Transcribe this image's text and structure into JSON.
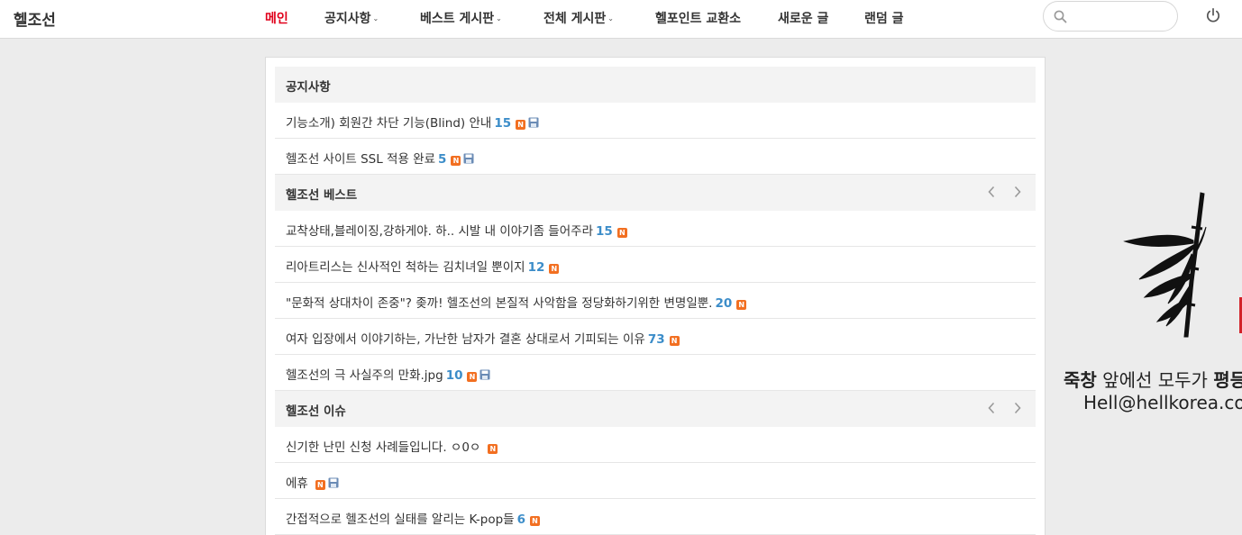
{
  "header": {
    "logo": "헬조선",
    "nav": [
      {
        "label": "메인",
        "active": true,
        "dropdown": false
      },
      {
        "label": "공지사항",
        "active": false,
        "dropdown": true
      },
      {
        "label": "베스트 게시판",
        "active": false,
        "dropdown": true
      },
      {
        "label": "전체 게시판",
        "active": false,
        "dropdown": true
      },
      {
        "label": "헬포인트 교환소",
        "active": false,
        "dropdown": false
      },
      {
        "label": "새로운 글",
        "active": false,
        "dropdown": false
      },
      {
        "label": "랜덤 글",
        "active": false,
        "dropdown": false
      }
    ],
    "search": {
      "value": "",
      "placeholder": ""
    },
    "icons": {
      "search": "search-icon",
      "power": "power-icon"
    }
  },
  "sections": [
    {
      "title": "공지사항",
      "has_arrows": false,
      "items": [
        {
          "text": "기능소개) 회원간 차단 기능(Blind) 안내",
          "count": "15",
          "new": true,
          "attachment": true
        },
        {
          "text": "헬조선 사이트 SSL 적용 완료",
          "count": "5",
          "new": true,
          "attachment": true
        }
      ]
    },
    {
      "title": "헬조선 베스트",
      "has_arrows": true,
      "items": [
        {
          "text": "교착상태,블레이징,강하게야. 하.. 시발 내 이야기좀 들어주라",
          "count": "15",
          "new": true,
          "attachment": false
        },
        {
          "text": "리아트리스는 신사적인 척하는 김치녀일 뿐이지",
          "count": "12",
          "new": true,
          "attachment": false
        },
        {
          "text": "\"문화적 상대차이 존중\"? 좆까! 헬조선의 본질적 사악함을 정당화하기위한 변명일뿐.",
          "count": "20",
          "new": true,
          "attachment": false
        },
        {
          "text": "여자 입장에서 이야기하는, 가난한 남자가 결혼 상대로서 기피되는 이유",
          "count": "73",
          "new": true,
          "attachment": false
        },
        {
          "text": "헬조선의 극 사실주의 만화.jpg",
          "count": "10",
          "new": true,
          "attachment": true
        }
      ]
    },
    {
      "title": "헬조선 이슈",
      "has_arrows": true,
      "items": [
        {
          "text": "신기한 난민 신청 사례들입니다. ㅇ0ㅇ",
          "count": "",
          "new": true,
          "attachment": false
        },
        {
          "text": "에휴",
          "count": "",
          "new": true,
          "attachment": true
        },
        {
          "text": "간접적으로 헬조선의 실태를 알리는 K-pop들",
          "count": "6",
          "new": true,
          "attachment": false
        }
      ]
    }
  ],
  "badge_new_label": "N",
  "sidebar": {
    "slogan_bold_1": "죽창",
    "slogan_mid": " 앞에선 모두가 ",
    "slogan_bold_2": "평등",
    "email": "Hell@hellkorea.com"
  },
  "colors": {
    "accent_red": "#e0001b",
    "count_blue": "#3c8dc9",
    "badge_orange": "#f26f21"
  }
}
